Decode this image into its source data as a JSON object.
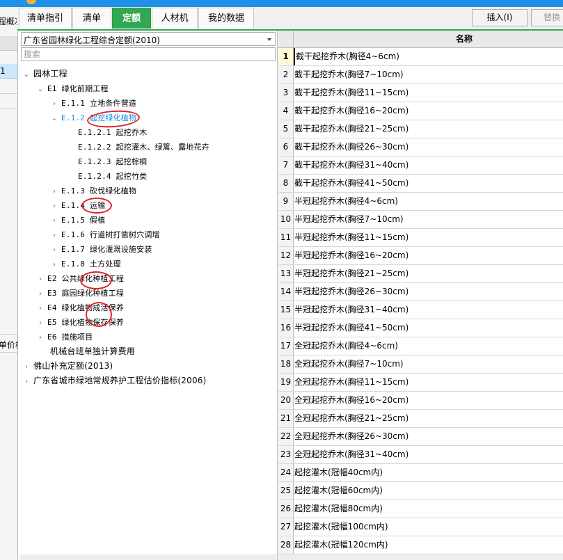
{
  "colors": {
    "title_bar": "#1E90E8",
    "active_tab": "#32A852",
    "annotation_red": "#E0242A",
    "tree_highlight": "#1A8FD8",
    "selected_row": "#CCE8FF"
  },
  "left_pane": {
    "clipped_text_top": "程概况",
    "selected_value": "1",
    "clipped_text_bottom": "单价构"
  },
  "tabs": [
    {
      "label": "清单指引",
      "active": false
    },
    {
      "label": "清单",
      "active": false
    },
    {
      "label": "定额",
      "active": true
    },
    {
      "label": "人材机",
      "active": false
    },
    {
      "label": "我的数据",
      "active": false
    }
  ],
  "toolbar": {
    "insert_label": "插入(I)",
    "replace_label": "替换"
  },
  "library": {
    "selected": "广东省园林绿化工程综合定额(2010)",
    "search_placeholder": "搜索"
  },
  "tree": [
    {
      "label": "园林工程",
      "chevron": "expanded",
      "level": 0
    },
    {
      "label": "E1 绿化前期工程",
      "chevron": "expanded",
      "level": 1
    },
    {
      "label": "E.1.1 立地条件营造",
      "chevron": "collapsed",
      "level": 2
    },
    {
      "label": "E.1.2 起挖绿化植物",
      "chevron": "expanded",
      "level": 2,
      "highlight": true
    },
    {
      "label": "E.1.2.1 起挖乔木",
      "chevron": "none",
      "level": 3
    },
    {
      "label": "E.1.2.2 起挖灌木、绿篱、露地花卉",
      "chevron": "none",
      "level": 3
    },
    {
      "label": "E.1.2.3 起挖棕榈",
      "chevron": "none",
      "level": 3
    },
    {
      "label": "E.1.2.4 起挖竹类",
      "chevron": "none",
      "level": 3
    },
    {
      "label": "E.1.3 砍伐绿化植物",
      "chevron": "collapsed",
      "level": 2
    },
    {
      "label": "E.1.4 运输",
      "chevron": "collapsed",
      "level": 2
    },
    {
      "label": "E.1.5 假植",
      "chevron": "collapsed",
      "level": 2
    },
    {
      "label": "E.1.6 行道树打凿树穴调增",
      "chevron": "collapsed",
      "level": 2
    },
    {
      "label": "E.1.7 绿化灌溉设施安装",
      "chevron": "collapsed",
      "level": 2
    },
    {
      "label": "E.1.8 土方处理",
      "chevron": "collapsed",
      "level": 2
    },
    {
      "label": "E2 公共绿化种植工程",
      "chevron": "collapsed",
      "level": 1
    },
    {
      "label": "E3 庭园绿化种植工程",
      "chevron": "collapsed",
      "level": 1
    },
    {
      "label": "E4 绿化植物成活保养",
      "chevron": "collapsed",
      "level": 1
    },
    {
      "label": "E5 绿化植物保存保养",
      "chevron": "collapsed",
      "level": 1
    },
    {
      "label": "E6 措施项目",
      "chevron": "collapsed",
      "level": 1
    },
    {
      "label": "机械台班单独计算费用",
      "chevron": "none",
      "level": 1
    },
    {
      "label": "佛山补充定额(2013)",
      "chevron": "collapsed",
      "level": 0
    },
    {
      "label": "广东省城市绿地常规养护工程估价指标(2006)",
      "chevron": "collapsed",
      "level": 0
    }
  ],
  "grid": {
    "header_name": "名称",
    "rows": [
      {
        "no": "1",
        "name": "截干起挖乔木(胸径4~6cm)"
      },
      {
        "no": "2",
        "name": "截干起挖乔木(胸径7~10cm)"
      },
      {
        "no": "3",
        "name": "截干起挖乔木(胸径11~15cm)"
      },
      {
        "no": "4",
        "name": "截干起挖乔木(胸径16~20cm)"
      },
      {
        "no": "5",
        "name": "截干起挖乔木(胸径21~25cm)"
      },
      {
        "no": "6",
        "name": "截干起挖乔木(胸径26~30cm)"
      },
      {
        "no": "7",
        "name": "截干起挖乔木(胸径31~40cm)"
      },
      {
        "no": "8",
        "name": "截干起挖乔木(胸径41~50cm)"
      },
      {
        "no": "9",
        "name": "半冠起挖乔木(胸径4~6cm)"
      },
      {
        "no": "10",
        "name": "半冠起挖乔木(胸径7~10cm)"
      },
      {
        "no": "11",
        "name": "半冠起挖乔木(胸径11~15cm)"
      },
      {
        "no": "12",
        "name": "半冠起挖乔木(胸径16~20cm)"
      },
      {
        "no": "13",
        "name": "半冠起挖乔木(胸径21~25cm)"
      },
      {
        "no": "14",
        "name": "半冠起挖乔木(胸径26~30cm)"
      },
      {
        "no": "15",
        "name": "半冠起挖乔木(胸径31~40cm)"
      },
      {
        "no": "16",
        "name": "半冠起挖乔木(胸径41~50cm)"
      },
      {
        "no": "17",
        "name": "全冠起挖乔木(胸径4~6cm)"
      },
      {
        "no": "18",
        "name": "全冠起挖乔木(胸径7~10cm)"
      },
      {
        "no": "19",
        "name": "全冠起挖乔木(胸径11~15cm)"
      },
      {
        "no": "20",
        "name": "全冠起挖乔木(胸径16~20cm)"
      },
      {
        "no": "21",
        "name": "全冠起挖乔木(胸径21~25cm)"
      },
      {
        "no": "22",
        "name": "全冠起挖乔木(胸径26~30cm)"
      },
      {
        "no": "23",
        "name": "全冠起挖乔木(胸径31~40cm)"
      },
      {
        "no": "24",
        "name": "起挖灌木(冠幅40cm内)"
      },
      {
        "no": "25",
        "name": "起挖灌木(冠幅60cm内)"
      },
      {
        "no": "26",
        "name": "起挖灌木(冠幅80cm内)"
      },
      {
        "no": "27",
        "name": "起挖灌木(冠幅100cm内)"
      },
      {
        "no": "28",
        "name": "起挖灌木(冠幅120cm内)"
      }
    ]
  }
}
